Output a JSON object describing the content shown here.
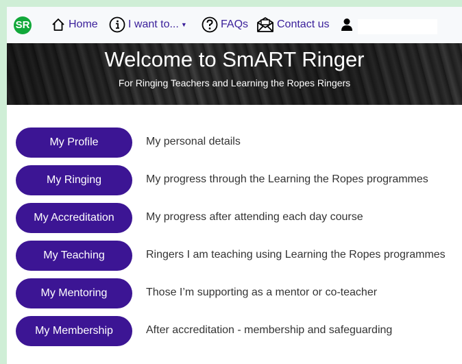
{
  "nav": {
    "logo": "SR",
    "home": "Home",
    "i_want_to": "I want to...",
    "faqs": "FAQs",
    "contact": "Contact us",
    "user_value": ""
  },
  "banner": {
    "title": "Welcome to SmART Ringer",
    "subtitle": "For Ringing Teachers and Learning the Ropes Ringers"
  },
  "menu": [
    {
      "label": "My Profile",
      "description": "My personal details"
    },
    {
      "label": "My Ringing",
      "description": "My progress through the Learning the Ropes programmes"
    },
    {
      "label": "My Accreditation",
      "description": "My progress after attending each day course"
    },
    {
      "label": "My Teaching",
      "description": "Ringers I am teaching using Learning the Ropes programmes"
    },
    {
      "label": "My Mentoring",
      "description": "Those I’m supporting as a mentor or co-teacher"
    },
    {
      "label": "My Membership",
      "description": "After accreditation - membership and safeguarding"
    }
  ],
  "colors": {
    "accent": "#3c1594",
    "logo": "#12a83a",
    "page_border": "#cfeed6"
  }
}
